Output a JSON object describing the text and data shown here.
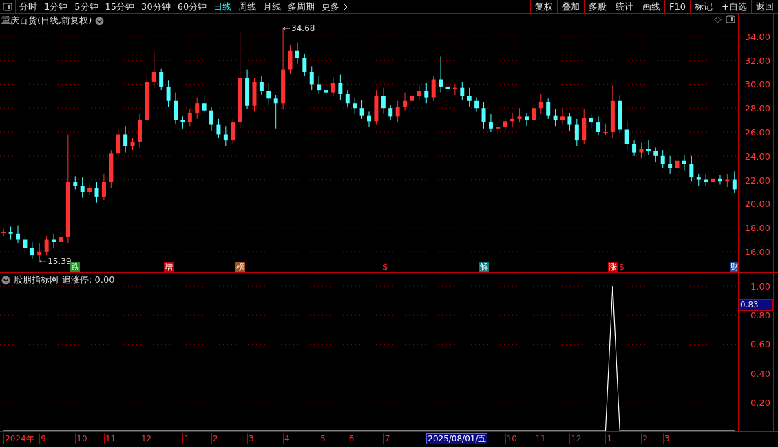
{
  "toolbar": {
    "periods": [
      {
        "label": "分时",
        "selected": false
      },
      {
        "label": "1分钟",
        "selected": false
      },
      {
        "label": "5分钟",
        "selected": false
      },
      {
        "label": "15分钟",
        "selected": false
      },
      {
        "label": "30分钟",
        "selected": false
      },
      {
        "label": "60分钟",
        "selected": false
      },
      {
        "label": "日线",
        "selected": true
      },
      {
        "label": "周线",
        "selected": false
      },
      {
        "label": "月线",
        "selected": false
      },
      {
        "label": "多周期",
        "selected": false
      }
    ],
    "more": "更多",
    "buttons": [
      "复权",
      "叠加",
      "多股",
      "统计",
      "画线",
      "F10",
      "标记",
      "+自选",
      "返回"
    ]
  },
  "main_chart": {
    "title": "重庆百货(日线,前复权)",
    "chart_data": {
      "type": "candlestick",
      "grid": true,
      "ylim": [
        14.27,
        35.89
      ],
      "yticks": [
        {
          "value": 16,
          "label": "16.00"
        },
        {
          "value": 18,
          "label": "18.00"
        },
        {
          "value": 20,
          "label": "20.00"
        },
        {
          "value": 22,
          "label": "22.00"
        },
        {
          "value": 24,
          "label": "24.00"
        },
        {
          "value": 26,
          "label": "26.00"
        },
        {
          "value": 28,
          "label": "28.00"
        },
        {
          "value": 30,
          "label": "30.00"
        },
        {
          "value": 32,
          "label": "32.00"
        },
        {
          "value": 34,
          "label": "34.00"
        }
      ],
      "ohlc": [
        [
          17.6,
          17.9,
          17.3,
          17.6
        ],
        [
          17.6,
          18.1,
          17.0,
          17.5
        ],
        [
          17.5,
          18.2,
          16.7,
          17.0
        ],
        [
          17.0,
          17.3,
          15.8,
          16.3
        ],
        [
          16.3,
          16.8,
          15.39,
          15.7
        ],
        [
          15.7,
          16.7,
          15.2,
          16.0
        ],
        [
          16.0,
          17.3,
          15.7,
          17.0
        ],
        [
          17.0,
          17.5,
          16.3,
          16.8
        ],
        [
          16.8,
          17.9,
          16.5,
          17.2
        ],
        [
          17.2,
          25.8,
          16.7,
          21.8
        ],
        [
          21.8,
          22.3,
          21.2,
          21.5
        ],
        [
          21.5,
          22.2,
          20.5,
          21.0
        ],
        [
          21.0,
          21.6,
          20.7,
          21.3
        ],
        [
          21.3,
          21.8,
          20.1,
          20.6
        ],
        [
          20.6,
          22.5,
          20.3,
          21.8
        ],
        [
          21.8,
          24.5,
          21.3,
          24.2
        ],
        [
          24.2,
          26.3,
          23.9,
          25.8
        ],
        [
          25.8,
          26.5,
          24.3,
          24.8
        ],
        [
          24.8,
          25.5,
          24.5,
          25.2
        ],
        [
          25.2,
          27.5,
          24.7,
          27.0
        ],
        [
          27.0,
          30.9,
          26.7,
          30.2
        ],
        [
          30.2,
          32.8,
          29.7,
          31.0
        ],
        [
          31.0,
          31.3,
          29.5,
          29.8
        ],
        [
          29.8,
          30.3,
          28.1,
          28.6
        ],
        [
          28.6,
          29.3,
          26.7,
          27.0
        ],
        [
          27.0,
          27.3,
          26.3,
          26.8
        ],
        [
          26.8,
          27.9,
          26.5,
          27.6
        ],
        [
          27.6,
          28.9,
          27.1,
          28.4
        ],
        [
          28.4,
          29.1,
          27.5,
          27.8
        ],
        [
          27.8,
          28.1,
          26.1,
          26.6
        ],
        [
          26.6,
          27.1,
          25.5,
          25.8
        ],
        [
          25.8,
          26.5,
          24.8,
          25.3
        ],
        [
          25.3,
          27.1,
          25.0,
          26.8
        ],
        [
          26.8,
          34.4,
          26.3,
          30.5
        ],
        [
          30.5,
          31.2,
          27.9,
          28.2
        ],
        [
          28.2,
          30.5,
          27.7,
          30.2
        ],
        [
          30.2,
          30.7,
          29.1,
          29.4
        ],
        [
          29.4,
          30.1,
          28.3,
          28.8
        ],
        [
          28.8,
          29.1,
          26.3,
          28.4
        ],
        [
          28.4,
          34.68,
          27.9,
          31.2
        ],
        [
          31.2,
          33.3,
          30.9,
          32.8
        ],
        [
          32.8,
          33.5,
          31.7,
          32.2
        ],
        [
          32.2,
          32.5,
          30.7,
          31.0
        ],
        [
          31.0,
          31.5,
          29.5,
          30.0
        ],
        [
          30.0,
          30.7,
          29.2,
          29.5
        ],
        [
          29.5,
          29.8,
          28.8,
          29.3
        ],
        [
          29.3,
          30.6,
          29.0,
          30.1
        ],
        [
          30.1,
          30.8,
          28.7,
          29.2
        ],
        [
          29.2,
          29.5,
          28.1,
          28.4
        ],
        [
          28.4,
          28.9,
          27.5,
          28.0
        ],
        [
          28.0,
          28.7,
          27.1,
          27.4
        ],
        [
          27.4,
          27.7,
          26.4,
          26.9
        ],
        [
          26.9,
          29.5,
          26.6,
          29.0
        ],
        [
          29.0,
          29.7,
          27.5,
          28.0
        ],
        [
          28.0,
          28.3,
          27.0,
          27.3
        ],
        [
          27.3,
          28.6,
          26.8,
          28.1
        ],
        [
          28.1,
          29.3,
          27.8,
          28.6
        ],
        [
          28.6,
          29.3,
          28.1,
          29.0
        ],
        [
          29.0,
          29.9,
          28.7,
          29.4
        ],
        [
          29.4,
          30.1,
          28.4,
          28.9
        ],
        [
          28.9,
          30.7,
          28.6,
          30.4
        ],
        [
          30.4,
          32.3,
          29.3,
          29.8
        ],
        [
          29.8,
          30.5,
          29.3,
          29.6
        ],
        [
          29.6,
          30.0,
          29.1,
          29.7
        ],
        [
          29.7,
          30.2,
          28.7,
          29.0
        ],
        [
          29.0,
          29.7,
          28.1,
          28.6
        ],
        [
          28.6,
          28.9,
          27.7,
          28.0
        ],
        [
          28.0,
          28.5,
          26.3,
          26.8
        ],
        [
          26.8,
          27.5,
          26.0,
          26.3
        ],
        [
          26.3,
          26.7,
          25.8,
          26.4
        ],
        [
          26.4,
          27.2,
          26.1,
          26.9
        ],
        [
          26.9,
          27.6,
          26.4,
          27.1
        ],
        [
          27.1,
          28.0,
          26.8,
          27.3
        ],
        [
          27.3,
          27.6,
          26.5,
          27.0
        ],
        [
          27.0,
          28.5,
          26.7,
          28.0
        ],
        [
          28.0,
          29.2,
          27.5,
          28.5
        ],
        [
          28.5,
          28.8,
          27.1,
          27.4
        ],
        [
          27.4,
          27.9,
          26.5,
          27.0
        ],
        [
          27.0,
          28.0,
          26.7,
          27.3
        ],
        [
          27.3,
          27.6,
          26.1,
          26.6
        ],
        [
          26.6,
          27.1,
          24.8,
          25.3
        ],
        [
          25.3,
          27.9,
          25.0,
          27.2
        ],
        [
          27.2,
          27.5,
          26.3,
          26.8
        ],
        [
          26.8,
          27.3,
          25.7,
          26.0
        ],
        [
          26.0,
          26.7,
          25.7,
          26.0
        ],
        [
          26.0,
          29.9,
          25.5,
          28.6
        ],
        [
          28.6,
          29.1,
          25.9,
          26.2
        ],
        [
          26.2,
          26.9,
          24.5,
          25.0
        ],
        [
          25.0,
          25.3,
          24.0,
          24.3
        ],
        [
          24.3,
          25.1,
          23.8,
          24.6
        ],
        [
          24.6,
          25.3,
          24.1,
          24.4
        ],
        [
          24.4,
          24.7,
          23.5,
          24.0
        ],
        [
          24.0,
          24.5,
          23.0,
          23.3
        ],
        [
          23.3,
          24.0,
          22.5,
          23.0
        ],
        [
          23.0,
          23.9,
          22.7,
          23.6
        ],
        [
          23.6,
          24.1,
          22.8,
          23.3
        ],
        [
          23.3,
          24.0,
          21.9,
          22.2
        ],
        [
          22.2,
          22.5,
          21.5,
          22.0
        ],
        [
          22.0,
          22.5,
          21.5,
          21.8
        ],
        [
          21.8,
          22.8,
          21.3,
          22.1
        ],
        [
          22.1,
          22.4,
          21.6,
          21.9
        ],
        [
          21.9,
          22.5,
          21.4,
          22.0
        ],
        [
          22.0,
          22.7,
          20.9,
          21.2
        ]
      ],
      "annotations": [
        "34.68",
        "15.39"
      ]
    },
    "events": [
      {
        "kind": "tag",
        "label": "跌",
        "color": "#1e8c1e"
      },
      {
        "kind": "tag",
        "label": "增",
        "color": "#c00000"
      },
      {
        "kind": "tag",
        "label": "榜",
        "color": "#a0521e"
      },
      {
        "kind": "mark",
        "label": "$",
        "color": "#ff2020"
      },
      {
        "kind": "tag",
        "label": "解",
        "color": "#107878"
      },
      {
        "kind": "tag",
        "label": "涨",
        "color": "#c00000"
      },
      {
        "kind": "mark",
        "label": "$",
        "color": "#ff2020"
      },
      {
        "kind": "tag",
        "label": "财",
        "color": "#1a4d9c"
      }
    ]
  },
  "indicator": {
    "name": "股朋指标网",
    "reading": "追涨停: 0.00",
    "readout": "0.83",
    "chart_data": {
      "type": "line",
      "grid": true,
      "ylim": [
        0,
        1.09
      ],
      "yticks": [
        {
          "value": 0.2,
          "label": "0.20"
        },
        {
          "value": 0.4,
          "label": "0.40"
        },
        {
          "value": 0.6,
          "label": "0.60"
        },
        {
          "value": 0.8,
          "label": "0.80"
        },
        {
          "value": 1.0,
          "label": "1.00"
        }
      ],
      "series": [
        {
          "color": "#ffffff",
          "values": [
            0,
            0,
            0,
            0,
            0,
            0,
            0,
            0,
            0,
            0,
            0,
            0,
            0,
            0,
            0,
            0,
            0,
            0,
            0,
            0,
            0,
            0,
            0,
            0,
            0,
            0,
            0,
            0,
            0,
            0,
            0,
            0,
            0,
            0,
            0,
            0,
            0,
            0,
            0,
            0,
            0,
            0,
            0,
            0,
            0,
            0,
            0,
            0,
            0,
            0,
            0,
            0,
            0,
            0,
            0,
            0,
            0,
            0,
            0,
            0,
            0,
            0,
            0,
            0,
            0,
            0,
            0,
            0,
            0,
            0,
            0,
            0,
            0,
            0,
            0,
            0,
            0,
            0,
            0,
            0,
            0,
            0,
            0,
            0,
            0,
            1,
            0,
            0,
            0,
            0,
            0,
            0,
            0,
            0,
            0,
            0,
            0,
            0,
            0,
            0,
            0,
            0,
            0
          ]
        }
      ]
    }
  },
  "date_axis": [
    {
      "label": "2024年",
      "selected": false
    },
    {
      "label": "9",
      "selected": false
    },
    {
      "label": "10",
      "selected": false
    },
    {
      "label": "11",
      "selected": false
    },
    {
      "label": "12",
      "selected": false
    },
    {
      "label": "1",
      "selected": false
    },
    {
      "label": "2",
      "selected": false
    },
    {
      "label": "3",
      "selected": false
    },
    {
      "label": "4",
      "selected": false
    },
    {
      "label": "5",
      "selected": false
    },
    {
      "label": "6",
      "selected": false
    },
    {
      "label": "7",
      "selected": false
    },
    {
      "label": "2025/08/01/五",
      "selected": true
    },
    {
      "label": "10",
      "selected": false
    },
    {
      "label": "11",
      "selected": false
    },
    {
      "label": "12",
      "selected": false
    },
    {
      "label": "1",
      "selected": false
    },
    {
      "label": "2",
      "selected": false
    },
    {
      "label": "3",
      "selected": false
    }
  ]
}
